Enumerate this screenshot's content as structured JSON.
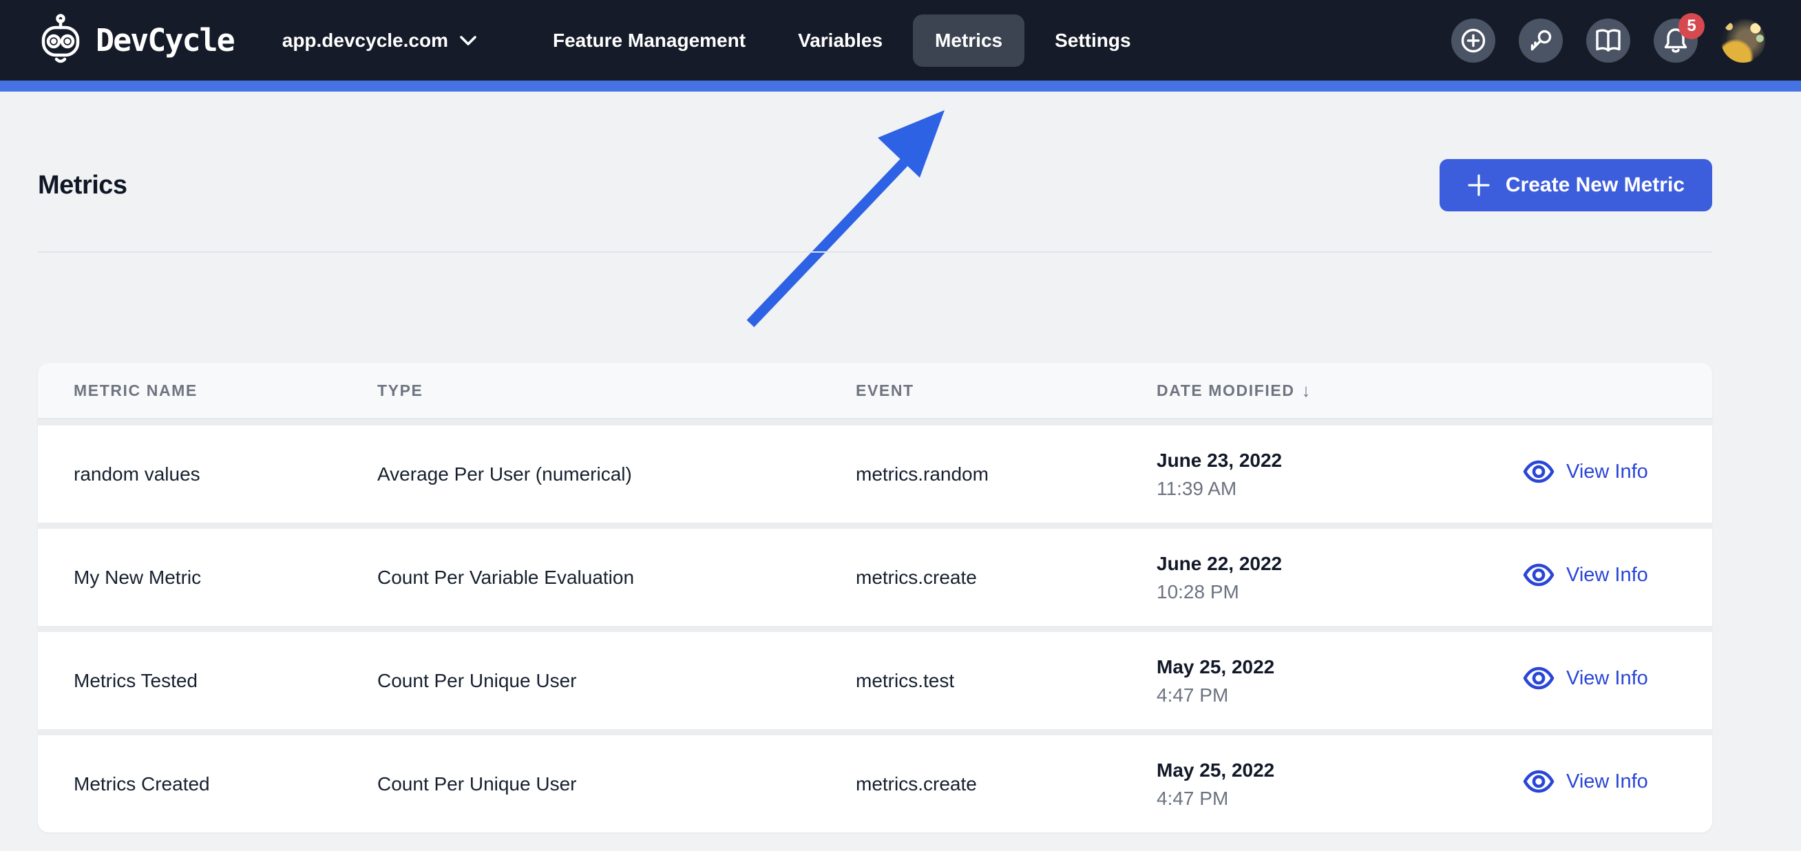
{
  "nav": {
    "brand": "DevCycle",
    "env_selector": "app.devcycle.com",
    "items": [
      {
        "label": "Feature Management",
        "active": false
      },
      {
        "label": "Variables",
        "active": false
      },
      {
        "label": "Metrics",
        "active": true
      },
      {
        "label": "Settings",
        "active": false
      }
    ],
    "icons": [
      "plus-circle-icon",
      "key-icon",
      "book-icon",
      "bell-icon",
      "avatar"
    ],
    "notification_count": "5"
  },
  "page": {
    "title": "Metrics",
    "create_button_label": "Create New Metric"
  },
  "table": {
    "headers": {
      "name": "METRIC NAME",
      "type": "TYPE",
      "event": "EVENT",
      "date": "DATE MODIFIED"
    },
    "sort_indicator": "↓",
    "action_label": "View Info",
    "rows": [
      {
        "name": "random values",
        "type": "Average Per User (numerical)",
        "event": "metrics.random",
        "date": "June 23, 2022",
        "time": "11:39 AM",
        "action": "View Info"
      },
      {
        "name": "My New Metric",
        "type": "Count Per Variable Evaluation",
        "event": "metrics.create",
        "date": "June 22, 2022",
        "time": "10:28 PM",
        "action": "View Info"
      },
      {
        "name": "Metrics Tested",
        "type": "Count Per Unique User",
        "event": "metrics.test",
        "date": "May 25, 2022",
        "time": "4:47 PM",
        "action": "View Info"
      },
      {
        "name": "Metrics Created",
        "type": "Count Per Unique User",
        "event": "metrics.create",
        "date": "May 25, 2022",
        "time": "4:47 PM",
        "action": "View Info"
      }
    ]
  },
  "colors": {
    "nav_background": "#151B28",
    "accent_bar": "#4573E6",
    "primary_button": "#3D5EDC",
    "link_blue": "#2946D6",
    "arrow_blue": "#2E62E4",
    "badge_red": "#D6494F",
    "page_background": "#F1F2F4"
  }
}
